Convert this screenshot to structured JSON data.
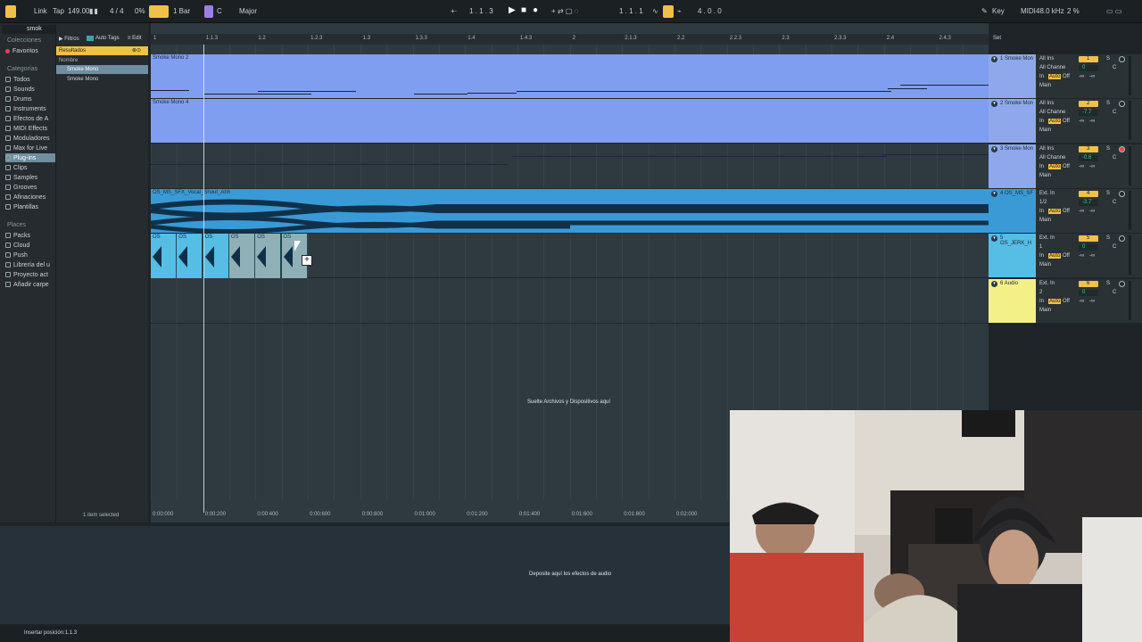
{
  "topbar": {
    "link": "Link",
    "tap": "Tap",
    "tempo": "149.00",
    "time_sig": "4 / 4",
    "cpu": "0%",
    "quantize": "1 Bar",
    "key_root": "C",
    "scale": "Major",
    "position": "1 . 1 . 3",
    "loop_start": "1 . 1 . 1",
    "loop_length": "4 . 0 . 0",
    "key_label": "Key",
    "midi_label": "MIDI",
    "sample_rate": "48.0 kHz",
    "cpu_load": "2 %"
  },
  "browser": {
    "search_value": "smok",
    "collections_label": "Colecciones",
    "favorites": "Favoritos",
    "categories_label": "Categorías",
    "categories": [
      "Todos",
      "Sounds",
      "Drums",
      "Instruments",
      "Efectos de A",
      "MIDI Effects",
      "Moduladores",
      "Max for Live",
      "Plug-ins",
      "Clips",
      "Samples",
      "Grooves",
      "Afinaciones",
      "Plantillas"
    ],
    "places_label": "Places",
    "places": [
      "Packs",
      "Cloud",
      "Push",
      "Librería del u",
      "Proyecto act",
      "Añadir carpe"
    ],
    "filters": "Filtros",
    "auto_tags": "Auto Tags",
    "edit": "Edit",
    "results_label": "Resultados",
    "column_name": "Nombre",
    "results": [
      "Smoke Mono",
      "Smoke Mono"
    ],
    "footer": "1 item selected"
  },
  "ruler": {
    "marks": [
      "1",
      "1.1.3",
      "1.2",
      "1.2.3",
      "1.3",
      "1.3.3",
      "1.4",
      "1.4.3",
      "2",
      "2.1.3",
      "2.2",
      "2.2.3",
      "2.3",
      "2.3.3",
      "2.4",
      "2.4.3"
    ],
    "set_label": "Set"
  },
  "timeline": [
    "0:00:000",
    "0:00:200",
    "0:00:400",
    "0:00:600",
    "0:00:800",
    "0:01:000",
    "0:01:200",
    "0:01:400",
    "0:01:600",
    "0:01:800",
    "0:02:000"
  ],
  "tracks": [
    {
      "clip": "Smoke Mono 2",
      "name": "1 Smoke Mon",
      "input": "All Ins",
      "channel": "All Channe",
      "number": "1",
      "vol": "0",
      "pan": "C",
      "out": "Main"
    },
    {
      "clip": "Smoke Mono 4",
      "name": "2 Smoke Mon",
      "input": "All Ins",
      "channel": "All Channe",
      "number": "2",
      "vol": "-7.7",
      "pan": "C",
      "out": "Main"
    },
    {
      "clip": "",
      "name": "3 Smoke Mon",
      "input": "All Ins",
      "channel": "All Channe",
      "number": "3",
      "vol": "-0.6",
      "pan": "C",
      "out": "Main"
    },
    {
      "clip": "OS_MS_SFX_Vocal_Shout_Ahh",
      "name": "4 OS_MS_SF",
      "input": "Ext. In",
      "channel": "1/2",
      "number": "4",
      "vol": "-3.7",
      "pan": "C",
      "out": "Main"
    },
    {
      "clip": "OS",
      "name": "5 OS_JERK_H",
      "input": "Ext. In",
      "channel": "1",
      "number": "5",
      "vol": "0",
      "pan": "C",
      "out": "Main"
    },
    {
      "clip": "",
      "name": "6 Audio",
      "input": "Ext. In",
      "channel": "2",
      "number": "6",
      "vol": "0",
      "pan": "C",
      "out": "Main"
    }
  ],
  "mixer_labels": {
    "in": "In",
    "auto": "Auto",
    "off": "Off",
    "inf": "-∞",
    "s": "S"
  },
  "drop_text": "Suelte Archivos y Dispositivos aquí",
  "device_drop_text": "Deposite aquí los efectos de audio",
  "status_text": "Insertar posición:1.1.3",
  "colors": {
    "midi_clip": "#7f9ef0",
    "audio_clip": "#3a9ad6",
    "audio2_clip": "#56bde5",
    "audio6": "#f4f088",
    "accent": "#f0c148"
  }
}
